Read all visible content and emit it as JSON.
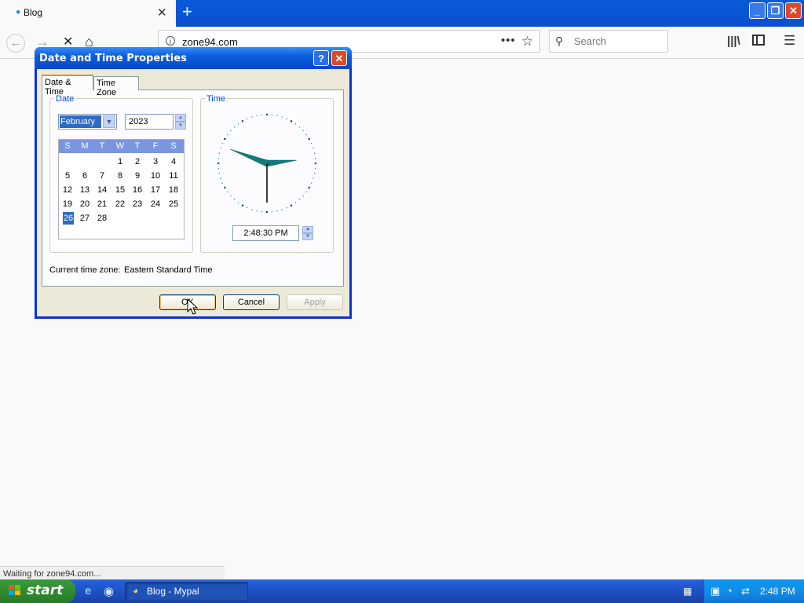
{
  "browser": {
    "tab_title": "Blog",
    "url": "zone94.com",
    "search_placeholder": "Search",
    "status_text": "Waiting for zone94.com..."
  },
  "dialog": {
    "title": "Date and Time Properties",
    "help_label": "?",
    "close_label": "✕",
    "tabs": [
      {
        "label": "Date & Time",
        "selected": true
      },
      {
        "label": "Time Zone",
        "selected": false
      }
    ],
    "date_group_label": "Date",
    "time_group_label": "Time",
    "month": "February",
    "year": "2023",
    "calendar": {
      "weekdays": [
        "S",
        "M",
        "T",
        "W",
        "T",
        "F",
        "S"
      ],
      "weeks": [
        [
          "",
          "",
          "",
          "1",
          "2",
          "3",
          "4"
        ],
        [
          "5",
          "6",
          "7",
          "8",
          "9",
          "10",
          "11"
        ],
        [
          "12",
          "13",
          "14",
          "15",
          "16",
          "17",
          "18"
        ],
        [
          "19",
          "20",
          "21",
          "22",
          "23",
          "24",
          "25"
        ],
        [
          "26",
          "27",
          "28",
          "",
          "",
          "",
          ""
        ]
      ],
      "selected_day": "26"
    },
    "time": "2:48:30 PM",
    "clock": {
      "hours": 14,
      "minutes": 48,
      "seconds": 30
    },
    "timezone_label": "Current time zone:",
    "timezone_value": "Eastern Standard Time",
    "buttons": {
      "ok": "OK",
      "cancel": "Cancel",
      "apply": "Apply"
    }
  },
  "taskbar": {
    "start_label": "start",
    "task_label": "Blog - Mypal",
    "clock": "2:48 PM"
  }
}
